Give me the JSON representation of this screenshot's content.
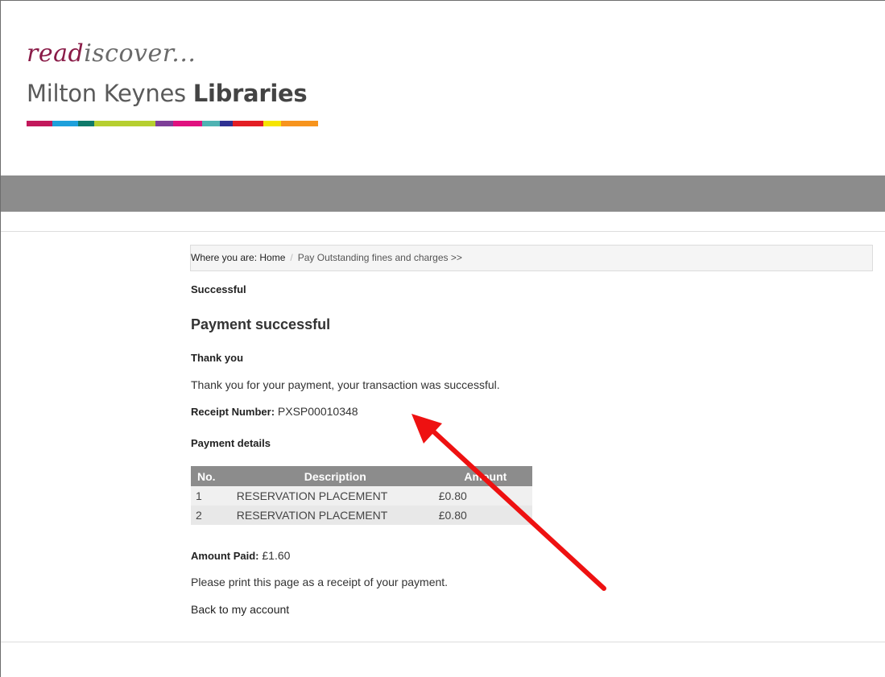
{
  "header": {
    "logo_script_lead": "read",
    "logo_script_rest": "iscover...",
    "logo_title_plain": "Milton Keynes ",
    "logo_title_bold": "Libraries",
    "logo_bar_colors": [
      "#c2185b",
      "#1ea0db",
      "#0f7a6a",
      "#b6cf2f",
      "#7e3f98",
      "#e0117f",
      "#4fb3b3",
      "#2e3192",
      "#e31e24",
      "#f6e500",
      "#f7941d"
    ]
  },
  "breadcrumb": {
    "prefix": "Where you are: ",
    "home": "Home",
    "separator": "/",
    "current": "Pay Outstanding fines and charges >>"
  },
  "main": {
    "status_label": "Successful",
    "heading": "Payment successful",
    "thank_you_heading": "Thank you",
    "thank_you_text": "Thank you for your payment, your transaction was successful.",
    "receipt_label": "Receipt Number:",
    "receipt_number": "PXSP00010348",
    "details_heading": "Payment details",
    "table": {
      "headers": [
        "No.",
        "Description",
        "Amount"
      ],
      "rows": [
        {
          "no": "1",
          "description": "RESERVATION PLACEMENT",
          "amount": "£0.80"
        },
        {
          "no": "2",
          "description": "RESERVATION PLACEMENT",
          "amount": "£0.80"
        }
      ]
    },
    "amount_paid_label": "Amount Paid:",
    "amount_paid_value": "£1.60",
    "print_note": "Please print this page as a receipt of your payment.",
    "back_link": "Back to my account"
  },
  "annotation": {
    "arrow_color": "#ee1111"
  }
}
